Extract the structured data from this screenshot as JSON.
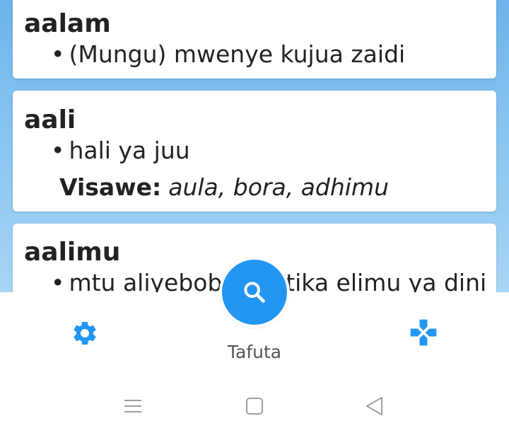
{
  "entries": [
    {
      "headword": "aalam",
      "bullet": "•",
      "definition": "(Mungu) mwenye kujua zaidi"
    },
    {
      "headword": "aali",
      "bullet": "•",
      "definition": "hali ya juu",
      "synonyms_label": "Visawe:",
      "synonyms": "aula, bora, adhimu"
    },
    {
      "headword": "aalimu",
      "bullet": "•",
      "definition": "mtu aliyebobea katika elimu ya dini"
    }
  ],
  "bottom_nav": {
    "search_label": "Tafuta",
    "settings_icon": "gear-icon",
    "games_icon": "gamepad-icon",
    "search_icon": "search-icon"
  },
  "colors": {
    "accent": "#2196f3",
    "background_gradient_top": "#6cb4ec",
    "background_gradient_bottom": "#a9d5f5",
    "text": "#222222",
    "system_icons": "#9e9e9e"
  }
}
